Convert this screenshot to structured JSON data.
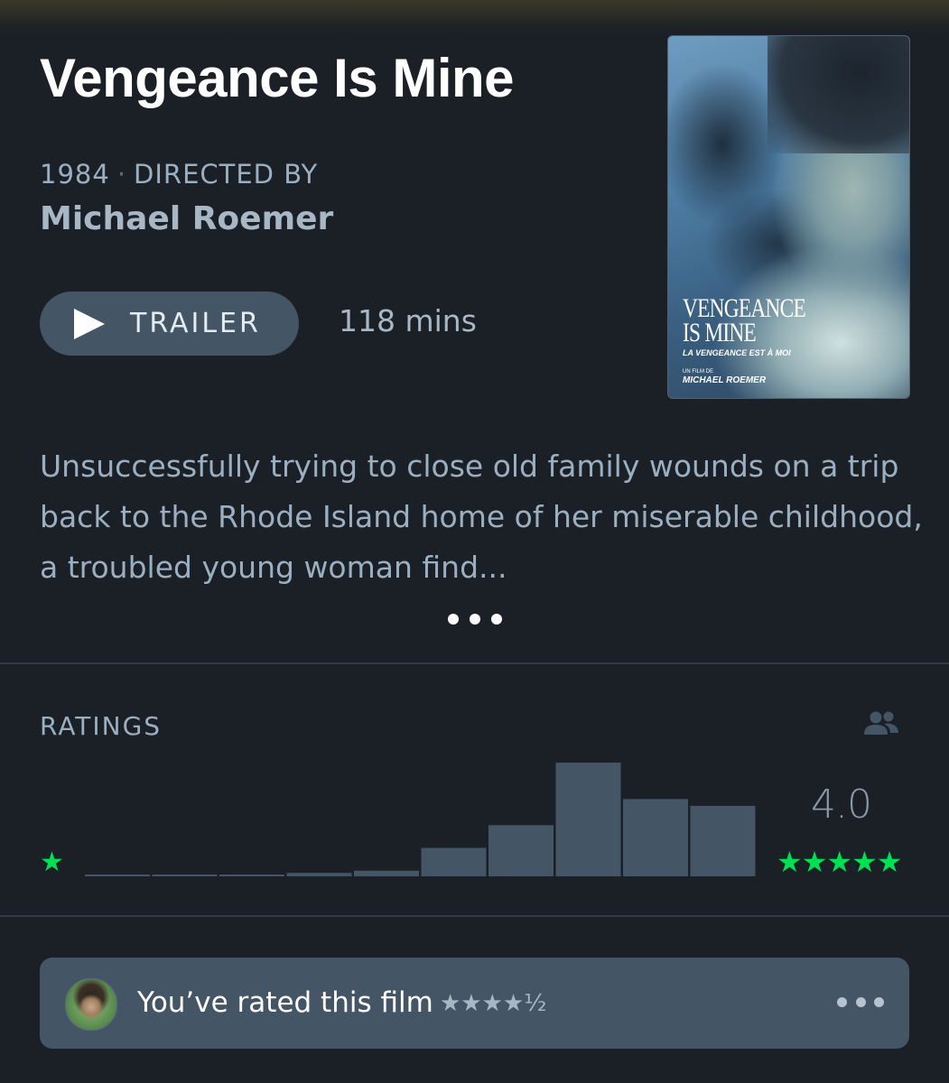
{
  "film": {
    "title": "Vengeance Is Mine",
    "year": "1984",
    "directed_by_label": "DIRECTED BY",
    "separator": "·",
    "director": "Michael Roemer",
    "runtime": "118 mins"
  },
  "trailer": {
    "label": "TRAILER",
    "icon": "play-icon"
  },
  "poster": {
    "title_line1": "VENGEANCE",
    "title_line2": "IS MINE",
    "subtitle": "LA VENGEANCE EST À MOI",
    "film_by": "UN FILM DE",
    "director": "MICHAEL ROEMER"
  },
  "synopsis": {
    "text": "Unsuccessfully trying to close old family wounds on a trip back to the Rhode Island home of her miserable childhood, a troubled young woman find...",
    "more_icon": "more-dots-icon"
  },
  "ratings": {
    "label": "RATINGS",
    "average": "4.0",
    "min_stars": "★",
    "max_stars": "★★★★★",
    "people_icon": "people-icon"
  },
  "chart_data": {
    "type": "bar",
    "categories": [
      "0.5",
      "1",
      "1.5",
      "2",
      "2.5",
      "3",
      "3.5",
      "4",
      "4.5",
      "5"
    ],
    "values": [
      0.5,
      0.5,
      0.5,
      3,
      5,
      25,
      45,
      100,
      68,
      62
    ],
    "ylim": [
      0,
      100
    ]
  },
  "your_rating": {
    "text": "You’ve rated this film",
    "stars": "★★★★½",
    "avatar": "user-avatar",
    "more_icon": "more-dots-icon"
  },
  "colors": {
    "background": "#1b1f26",
    "accent_green": "#00e054",
    "bar": "#445566",
    "button": "#445566"
  }
}
